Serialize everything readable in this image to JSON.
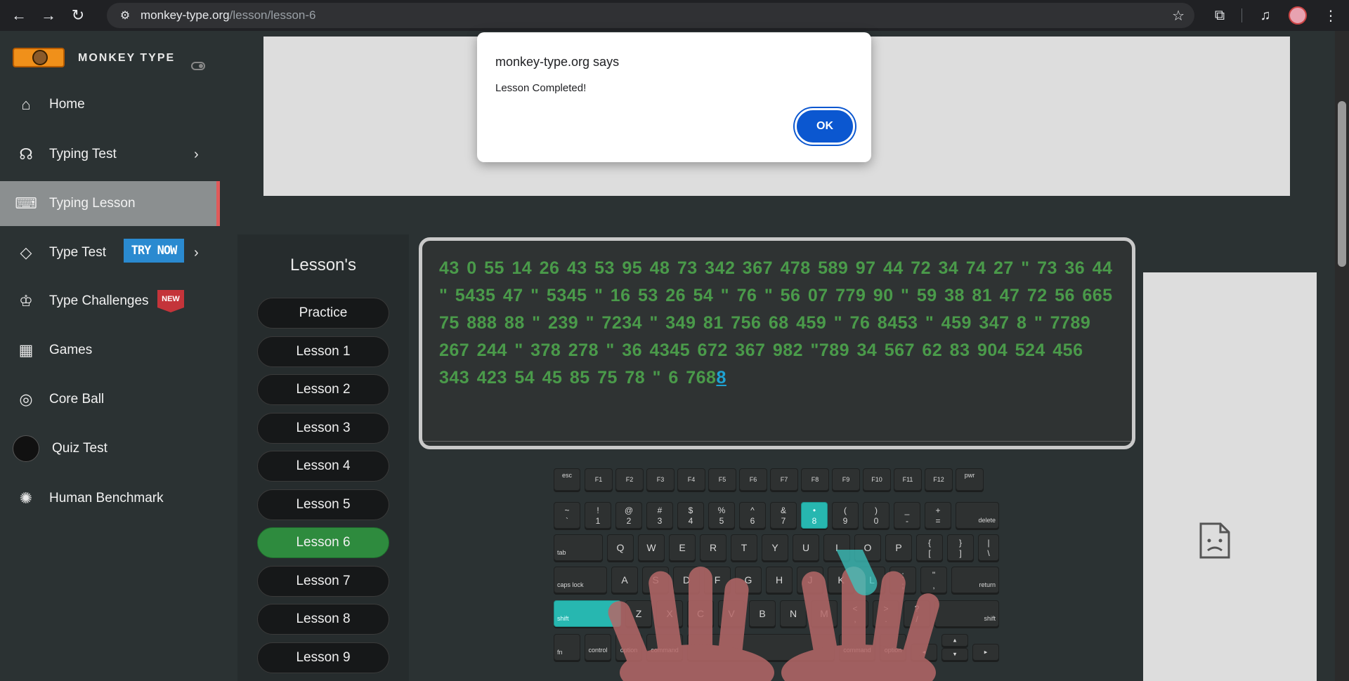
{
  "browser": {
    "url_host": "monkey-type.org",
    "url_path": "/lesson/lesson-6"
  },
  "sidebar": {
    "brand": "MONKEY TYPE",
    "items": [
      {
        "label": "Home",
        "icon": "home-icon"
      },
      {
        "label": "Typing Test",
        "icon": "github-icon"
      },
      {
        "label": "Typing Lesson",
        "icon": "keyboard-icon"
      },
      {
        "label": "Type Test",
        "icon": "gitlab-icon"
      },
      {
        "label": "Type Challenges",
        "icon": "award-icon"
      },
      {
        "label": "Games",
        "icon": "grid-icon"
      },
      {
        "label": "Core Ball",
        "icon": "target-icon"
      },
      {
        "label": "Quiz Test",
        "icon": "quiz-avatar-icon"
      },
      {
        "label": "Human Benchmark",
        "icon": "brain-icon"
      }
    ],
    "try_now_badge": "TRY NOW",
    "new_badge": "NEW",
    "active_accent": "#e05a5a"
  },
  "lessons": {
    "title": "Lesson's",
    "items": [
      "Practice",
      "Lesson 1",
      "Lesson 2",
      "Lesson 3",
      "Lesson 4",
      "Lesson 5",
      "Lesson 6",
      "Lesson 7",
      "Lesson 8",
      "Lesson 9"
    ],
    "active": "Lesson 6",
    "active_color": "#2e8b3e"
  },
  "typing": {
    "typed_text": "43 0 55 14 26 43 53 95 48 73 342 367 478 589 97 44 72 34 74 27 \" 73 36 44 \" 5435 47 \" 5345 \" 16 53 26 54 \" 76 \" 56 07 779 90 \" 59 38 81 47 72 56 665 75 888 88 \" 239 \" 7234 \" 349 81 756 68 459 \" 76 8453 \" 459 347 8 \" 7789 267 244 \" 378 278 \" 36 4345 672 367 982 \"789 34 567 62 83 904 524 456 343 423 54 45 85 75 78 \" 6 768",
    "current_char": "8",
    "typed_color": "#4a9a4a",
    "current_color": "#1ea2d2"
  },
  "keyboard": {
    "highlight_color": "#27b7b0",
    "fn_row": [
      "esc",
      "F1",
      "F2",
      "F3",
      "F4",
      "F5",
      "F6",
      "F7",
      "F8",
      "F9",
      "F10",
      "F11",
      "F12",
      "pwr"
    ],
    "num_row": [
      {
        "top": "~",
        "bot": "`"
      },
      {
        "top": "!",
        "bot": "1"
      },
      {
        "top": "@",
        "bot": "2"
      },
      {
        "top": "#",
        "bot": "3"
      },
      {
        "top": "$",
        "bot": "4"
      },
      {
        "top": "%",
        "bot": "5"
      },
      {
        "top": "^",
        "bot": "6"
      },
      {
        "top": "&",
        "bot": "7"
      },
      {
        "top": "•",
        "bot": "8"
      },
      {
        "top": "(",
        "bot": "9"
      },
      {
        "top": ")",
        "bot": "0"
      },
      {
        "top": "_",
        "bot": "-"
      },
      {
        "top": "+",
        "bot": "="
      }
    ],
    "delete": "delete",
    "tab": "tab",
    "row_q": [
      "Q",
      "W",
      "E",
      "R",
      "T",
      "Y",
      "U",
      "I",
      "O",
      "P"
    ],
    "row_q_sym": [
      {
        "top": "{",
        "bot": "["
      },
      {
        "top": "}",
        "bot": "]"
      },
      {
        "top": "|",
        "bot": "\\"
      }
    ],
    "caps": "caps lock",
    "row_a": [
      "A",
      "S",
      "D",
      "F",
      "G",
      "H",
      "J",
      "K",
      "L"
    ],
    "row_a_sym": [
      {
        "top": ":",
        "bot": ";"
      },
      {
        "top": "\"",
        "bot": ","
      }
    ],
    "return": "return",
    "shift_left": "shift",
    "row_z": [
      "Z",
      "X",
      "C",
      "V",
      "B",
      "N",
      "M"
    ],
    "row_z_sym": [
      {
        "top": "<",
        "bot": ","
      },
      {
        "top": ">",
        "bot": "."
      },
      {
        "top": "?",
        "bot": "/"
      }
    ],
    "shift_right": "shift",
    "bottom_row": [
      "fn",
      "control",
      "option",
      "command",
      "command",
      "option"
    ],
    "arrows": {
      "left": "◂",
      "up": "▴",
      "down": "▾",
      "right": "▸"
    }
  },
  "alert": {
    "title": "monkey-type.org says",
    "message": "Lesson Completed!",
    "ok_label": "OK"
  }
}
